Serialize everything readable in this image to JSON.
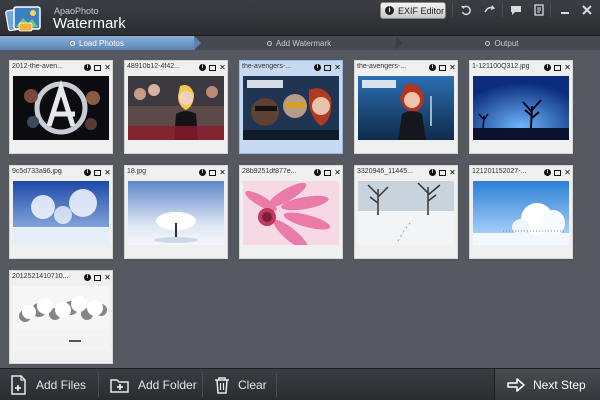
{
  "app": {
    "brand_small": "ApaoPhoto",
    "brand_big": "Watermark",
    "exif_button": "EXIF Editor"
  },
  "steps": [
    {
      "label": "Load Photos",
      "active": true
    },
    {
      "label": "Add Watermark",
      "active": false
    },
    {
      "label": "Output",
      "active": false
    }
  ],
  "photos": [
    {
      "filename": "2012-the-aven...",
      "scene": "avengers-logo",
      "selected": false
    },
    {
      "filename": "48910b12-4f42...",
      "scene": "red-carpet",
      "selected": false
    },
    {
      "filename": "the-avengers-...",
      "scene": "avengers-poster",
      "selected": true
    },
    {
      "filename": "the-avengers-...",
      "scene": "avengers-widow",
      "selected": false
    },
    {
      "filename": "1-121100Q312.jpg",
      "scene": "night-tree",
      "selected": false
    },
    {
      "filename": "9c5d733a96.jpg",
      "scene": "snow-trees-blue",
      "selected": false
    },
    {
      "filename": "18.jpg",
      "scene": "lone-tree",
      "selected": false
    },
    {
      "filename": "28b9251df877e...",
      "scene": "pink-flower",
      "selected": false
    },
    {
      "filename": "3320946_11445...",
      "scene": "snow-field",
      "selected": false
    },
    {
      "filename": "121201152027-...",
      "scene": "frost-trees",
      "selected": false
    },
    {
      "filename": "2012521410710...",
      "scene": "snow-bush",
      "selected": false
    }
  ],
  "toolbar": {
    "add_files": "Add Files",
    "add_folder": "Add Folder",
    "clear": "Clear",
    "next_step": "Next Step"
  },
  "titlebar_icons": [
    "undo-icon",
    "redo-icon",
    "chat-icon",
    "list-icon",
    "minimize-icon",
    "close-icon"
  ],
  "colors": {
    "accent": "#6f96c6",
    "selected_card": "#c8daf2",
    "background": "#55585e"
  }
}
